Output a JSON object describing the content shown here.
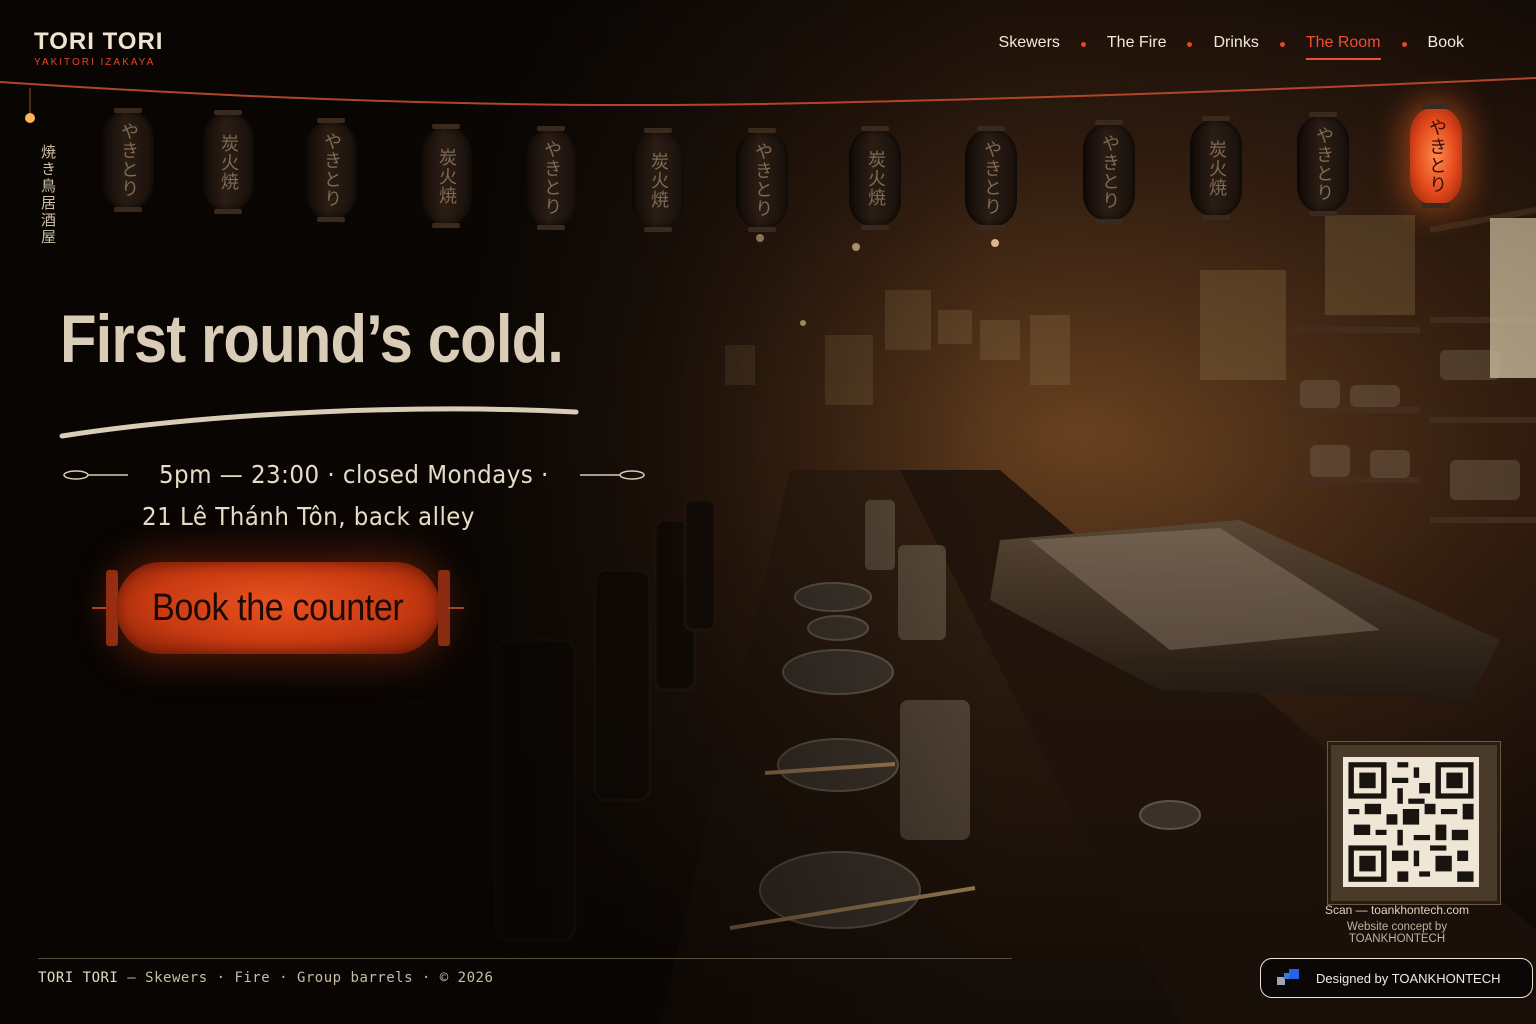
{
  "brand": {
    "name": "TORI TORI",
    "tagline": "YAKITORI IZAKAYA"
  },
  "nav": {
    "items": [
      {
        "label": "Skewers",
        "active": false
      },
      {
        "label": "The Fire",
        "active": false
      },
      {
        "label": "Drinks",
        "active": false
      },
      {
        "label": "The Room",
        "active": true
      },
      {
        "label": "Book",
        "active": false
      }
    ]
  },
  "lanterns": [
    "やきとり",
    "炭火焼",
    "やきとり",
    "炭火焼",
    "やきとり",
    "炭火焼",
    "やきとり",
    "炭火焼",
    "やきとり",
    "やきとり",
    "炭火焼",
    "やきとり",
    "やきとり"
  ],
  "vertical_tag": "焼き鳥居酒屋",
  "hero": {
    "headline": "First round’s cold.",
    "hours": "5pm — 23:00 · closed Mondays ·",
    "address": "21 Lê Thánh Tôn, back alley",
    "cta_label": "Book the counter"
  },
  "qr": {
    "caption": "Scan — toankhontech.com",
    "credit": "Website concept by TOANKHONTECH"
  },
  "footer": {
    "brand": "TORI TORI",
    "links": "— Skewers · Fire · Group barrels · © 2026"
  },
  "badge": {
    "label": "Designed by TOANKHONTECH"
  },
  "colors": {
    "accent": "#e5462a",
    "cta": "#d9471a",
    "background": "#0b0705",
    "text": "#e8dcc6"
  }
}
